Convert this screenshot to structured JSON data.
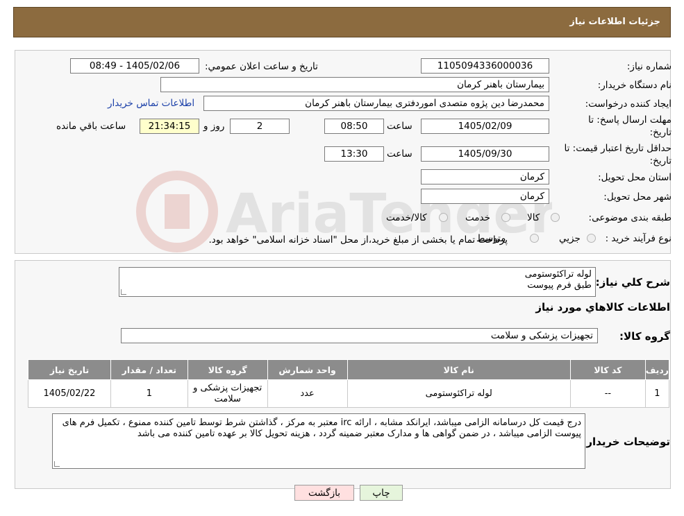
{
  "header": {
    "title": "جزئیات اطلاعات نیاز"
  },
  "form": {
    "need_number_label": "شماره نیاز:",
    "need_number": "1105094336000036",
    "announce_label": "تاریخ و ساعت اعلان عمومي:",
    "announce_value": "1405/02/06 - 08:49",
    "buyer_label": "نام دستگاه خریدار:",
    "buyer_value": "بیمارستان باهنر کرمان",
    "creator_label": "ایجاد کننده درخواست:",
    "creator_value": "محمدرضا  دین پژوه متصدی اموردفتری بیمارستان باهنر کرمان",
    "contact_link": "اطلاعات تماس خریدار",
    "deadline_label_1": "مهلت ارسال پاسخ: تا",
    "deadline_label_2": "تاریخ:",
    "deadline_date": "1405/02/09",
    "time_label": "ساعت",
    "deadline_time": "08:50",
    "days_value": "2",
    "days_label": "روز و",
    "remaining_time": "21:34:15",
    "remaining_label": "ساعت باقي مانده",
    "validity_label_1": "حداقل تاریخ اعتبار قیمت: تا",
    "validity_label_2": "تاریخ:",
    "validity_date": "1405/09/30",
    "validity_time": "13:30",
    "province_label": "استان محل تحویل:",
    "province_value": "کرمان",
    "city_label": "شهر محل تحویل:",
    "city_value": "کرمان",
    "category_label": "طبقه بندی موضوعی:",
    "category_options": [
      "کالا",
      "خدمت",
      "کالا/خدمت"
    ],
    "process_label": "نوع فرآیند خرید :",
    "process_options": [
      "جزیي",
      "متوسط"
    ],
    "process_note": "پرداخت تمام یا بخشی از مبلغ خرید،از محل \"اسناد خزانه اسلامی\" خواهد بود."
  },
  "description": {
    "label": "شرح کلي نیاز:",
    "line1": "لوله تراکئوستومی",
    "line2": "طبق فرم پیوست"
  },
  "goods_section": {
    "title": "اطلاعات کالاهاي مورد نیاز",
    "group_label": "گروه کالا:",
    "group_value": "تجهیزات پزشکی و سلامت"
  },
  "table": {
    "headers": [
      "ردیف",
      "کد کالا",
      "نام کالا",
      "واحد شمارش",
      "گروه کالا",
      "تعداد / مقدار",
      "تاریخ نیاز"
    ],
    "rows": [
      [
        "1",
        "--",
        "لوله تراکئوستومی",
        "عدد",
        "تجهیزات پزشکی و سلامت",
        "1",
        "1405/02/22"
      ]
    ]
  },
  "buyer_notes": {
    "label": "توضیحات خریدار:",
    "text": "درج قیمت کل درسامانه الزامی میباشد، ایرانکد مشابه ، ارائه irc معتبر به مرکز ، گذاشتن شرط توسط تامین کننده ممنوع ، تکمیل فرم های پیوست الزامی میباشد ، در ضمن گواهی ها و مدارک معتبر ضمینه گردد ، هزینه تحویل کالا بر عهده تامین کننده می باشد"
  },
  "buttons": {
    "print": "چاپ",
    "back": "بازگشت"
  },
  "colors": {
    "header": "#8c6b3f",
    "table_header": "#8c8c8c",
    "back_btn": "#ffe0e0",
    "print_btn": "#e6f5dc",
    "yellow": "#ffffcc"
  },
  "icons": {
    "watermark": "aria-tender-logo"
  }
}
